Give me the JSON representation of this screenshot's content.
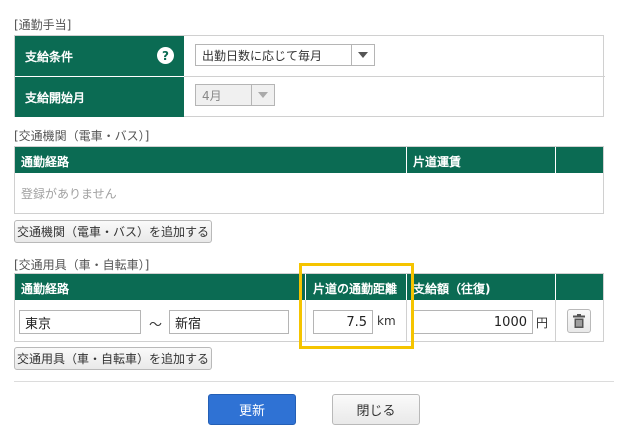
{
  "commute": {
    "section_label": "[通勤手当]",
    "condition_label": "支給条件",
    "condition_value": "出勤日数に応じて毎月",
    "start_month_label": "支給開始月",
    "start_month_value": "4月"
  },
  "transit": {
    "section_label": "[交通機関（電車・バス）]",
    "col_route": "通勤経路",
    "col_fare": "片道運賃",
    "empty_text": "登録がありません",
    "add_button": "交通機関（電車・バス）を追加する"
  },
  "vehicle": {
    "section_label": "[交通用具（車・自転車）]",
    "col_route": "通勤経路",
    "col_distance": "片道の通勤距離",
    "col_amount": "支給額（往復)",
    "from_value": "東京",
    "tilde": "～",
    "to_value": "新宿",
    "distance_value": "7.5",
    "distance_unit": "km",
    "amount_value": "1000",
    "amount_unit": "円",
    "add_button": "交通用具（車・自転車）を追加する"
  },
  "footer": {
    "update_button": "更新",
    "close_button": "閉じる"
  },
  "colors": {
    "header_green": "#0b6b53",
    "primary_blue": "#2f72d4",
    "highlight_yellow": "#f5c400"
  }
}
